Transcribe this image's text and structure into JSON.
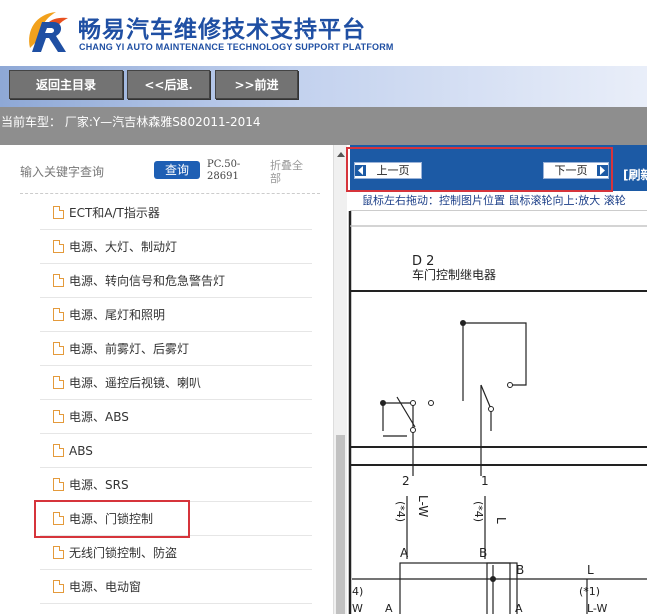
{
  "brand": {
    "title": "畅易汽车维修技术支持平台",
    "subtitle": "CHANG YI AUTO MAINTENANCE TECHNOLOGY SUPPORT PLATFORM"
  },
  "nav": {
    "home": "返回主目录",
    "back": "<<后退.",
    "forward": ">>前进"
  },
  "status": {
    "current_vehicle": "当前车型： 厂家:Y—汽吉林森雅S802011-2014"
  },
  "search": {
    "placeholder": "输入关键字查询",
    "button": "查询",
    "pc_code_line1": "PC.50-",
    "pc_code_line2": "28691",
    "collapse_line1": "折叠全",
    "collapse_line2": "部"
  },
  "tree": [
    "ECT和A/T指示器",
    "电源、大灯、制动灯",
    "电源、转向信号和危急警告灯",
    "电源、尾灯和照明",
    "电源、前雾灯、后雾灯",
    "电源、遥控后视镜、喇叭",
    "电源、ABS",
    "ABS",
    "电源、SRS",
    "电源、门锁控制",
    "无线门锁控制、防盗",
    "电源、电动窗"
  ],
  "pager": {
    "prev": "上一页",
    "next": "下一页",
    "refresh": "[刷新"
  },
  "hint": "鼠标左右拖动：控制图片位置 鼠标滚轮向上:放大  滚轮",
  "diagram": {
    "component_code": "D 2",
    "component_name": "车门控制继电器",
    "pin_2": "2",
    "pin_1": "1",
    "wire_lw": "L-W",
    "wire_l": "L",
    "note_left": "(*4)",
    "note_right": "(*4)",
    "conn_a1": "A",
    "conn_b1": "B",
    "conn_b2": "B",
    "wire_l2": "L",
    "note_4": "4)",
    "note_1": "(*1)",
    "bottom_w": "W",
    "bottom_a1": "A",
    "bottom_a2": "A",
    "bottom_lw": "L-W"
  },
  "colors": {
    "brand_blue": "#1f4fa3",
    "pager_blue": "#1c5aa5",
    "nav_button": "#737373",
    "highlight_red": "#d6343b",
    "doc_icon": "#e49a3b"
  }
}
